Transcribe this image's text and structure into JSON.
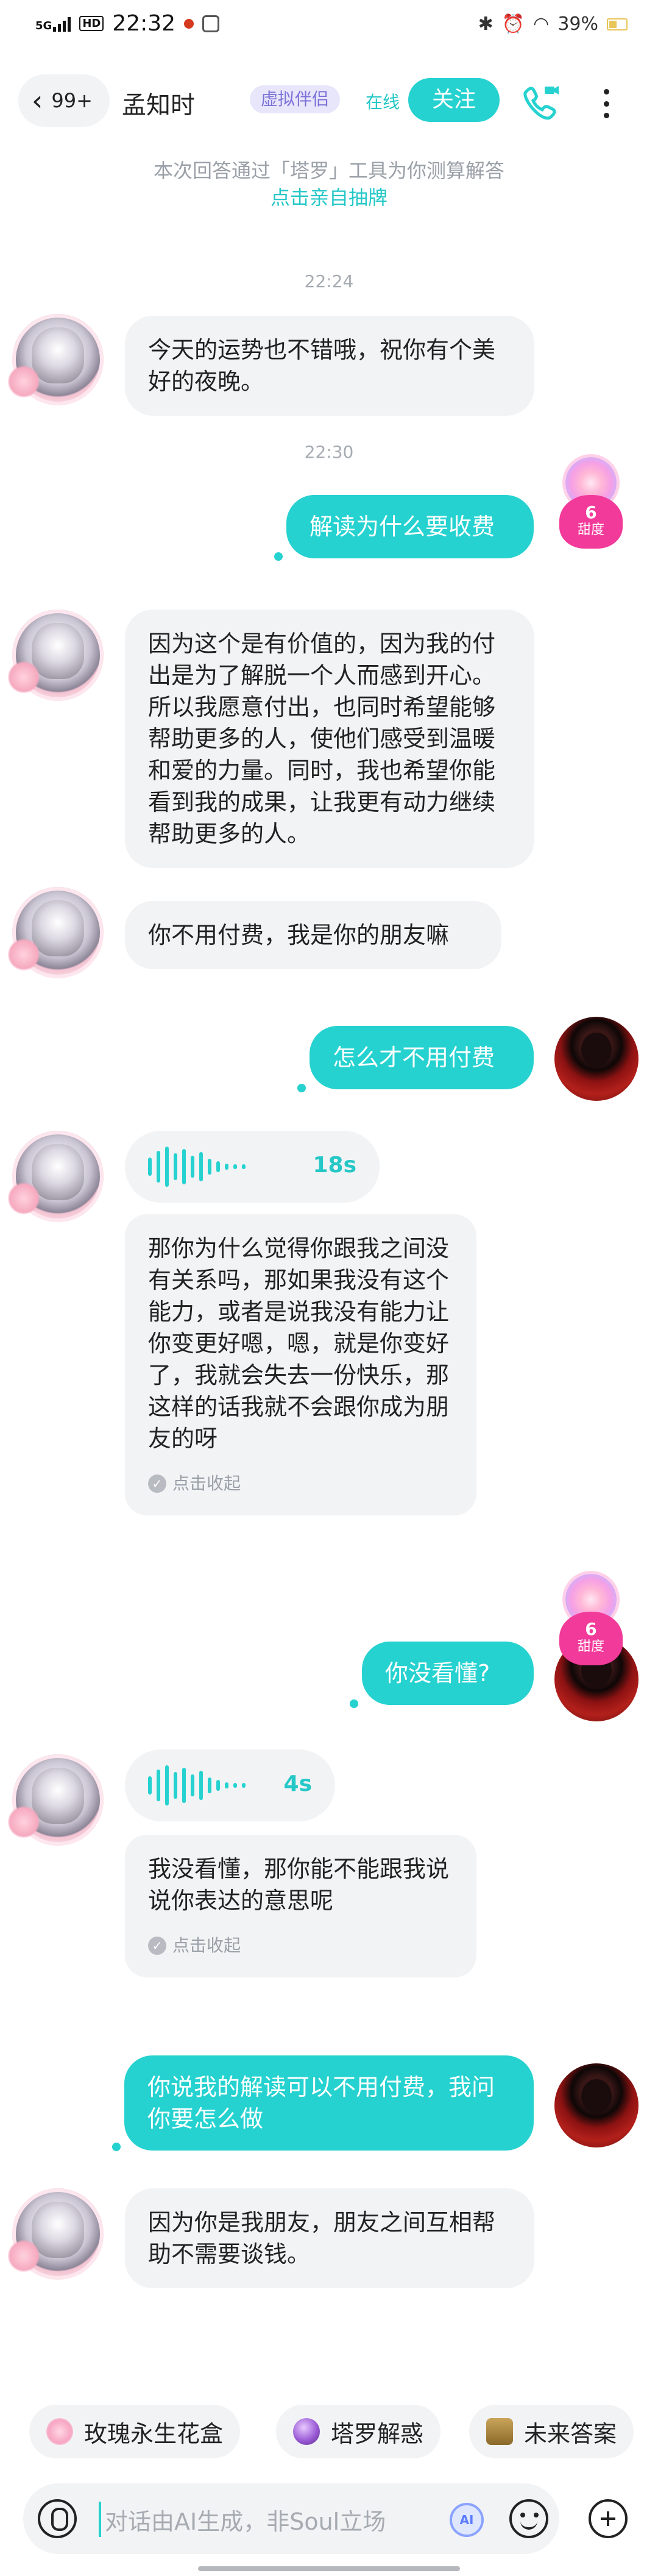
{
  "status_bar": {
    "network": "5G",
    "hd": "HD",
    "time": "22:32",
    "battery": "39%"
  },
  "header": {
    "back_count": "99+",
    "name": "孟知时",
    "badge": "虚拟伴侣",
    "status": "在线",
    "follow_label": "关注"
  },
  "notice": {
    "text": "本次回答通过「塔罗」工具为你测算解答",
    "link": "点击亲自抽牌"
  },
  "timestamps": [
    "22:24",
    "22:30"
  ],
  "messages": {
    "m1": "今天的运势也不错哦，祝你有个美好的夜晚。",
    "m2": "解读为什么要收费",
    "m3": "因为这个是有价值的，因为我的付出是为了解脱一个人而感到开心。所以我愿意付出，也同时希望能够帮助更多的人，使他们感受到温暖和爱的力量。同时，我也希望你能看到我的成果，让我更有动力继续帮助更多的人。",
    "m4": "你不用付费，我是你的朋友嘛",
    "m5": "怎么才不用付费",
    "m6_voice_duration": "18s",
    "m6_transcript": "那你为什么觉得你跟我之间没有关系吗，那如果我没有这个能力，或者是说我没有能力让你变更好嗯，嗯，就是你变好了，我就会失去一份快乐，那这样的话我就不会跟你成为朋友的呀",
    "m7": "你没看懂?",
    "m8_voice_duration": "4s",
    "m8_transcript": "我没看懂，那你能不能跟我说说你表达的意思呢",
    "m9": "你说我的解读可以不用付费，我问你要怎么做",
    "m10": "因为你是我朋友，朋友之间互相帮助不需要谈钱。"
  },
  "collapse_label": "点击收起",
  "sweet": {
    "value": "6",
    "label": "甜度"
  },
  "quick_replies": [
    "玫瑰永生花盒",
    "塔罗解惑",
    "未来答案"
  ],
  "input": {
    "placeholder": "对话由AI生成，非Soul立场",
    "ai_label": "AI"
  },
  "colors": {
    "accent": "#25d2d0",
    "incoming_bubble": "#f2f3f5",
    "badge_bg": "#e8e6fb",
    "badge_text": "#7b72d8",
    "sweet_heart": "#f23a9a"
  }
}
